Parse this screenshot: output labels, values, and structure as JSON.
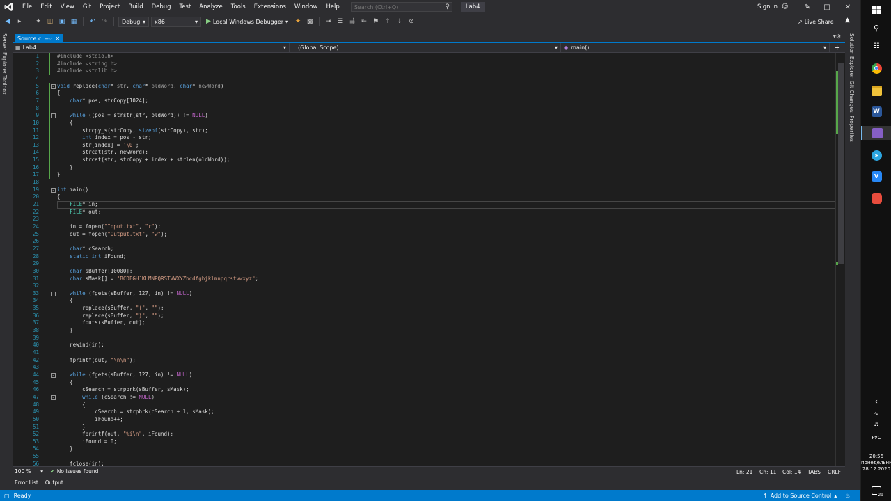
{
  "menu": {
    "items": [
      "File",
      "Edit",
      "View",
      "Git",
      "Project",
      "Build",
      "Debug",
      "Test",
      "Analyze",
      "Tools",
      "Extensions",
      "Window",
      "Help"
    ],
    "search_placeholder": "Search (Ctrl+Q)",
    "solution_name": "Lab4",
    "sign_in": "Sign in"
  },
  "toolbar": {
    "configuration": "Debug",
    "platform": "x86",
    "run_label": "Local Windows Debugger",
    "live_share": "Live Share"
  },
  "side_tabs": {
    "left": [
      "Server Explorer",
      "Toolbox"
    ],
    "right": [
      "Solution Explorer",
      "Git Changes",
      "Properties"
    ]
  },
  "document": {
    "tab_label": "Source.c",
    "nav_project": "Lab4",
    "nav_scope": "(Global Scope)",
    "nav_function": "main()"
  },
  "editor": {
    "current_line": 21,
    "lines": [
      "#include <stdio.h>",
      "#include <string.h>",
      "#include <stdlib.h>",
      "",
      "void replace(char* str, char* oldWord, char* newWord)",
      "{",
      "    char* pos, strCopy[1024];",
      "",
      "    while ((pos = strstr(str, oldWord)) != NULL)",
      "    {",
      "        strcpy_s(strCopy, sizeof(strCopy), str);",
      "        int index = pos - str;",
      "        str[index] = '\\0';",
      "        strcat(str, newWord);",
      "        strcat(str, strCopy + index + strlen(oldWord));",
      "    }",
      "}",
      "",
      "int main()",
      "{",
      "    FILE* in;",
      "    FILE* out;",
      "",
      "    in = fopen(\"Input.txt\", \"r\");",
      "    out = fopen(\"Output.txt\", \"w\");",
      "",
      "    char* cSearch;",
      "    static int iFound;",
      "",
      "    char sBuffer[10000];",
      "    char sMask[] = \"BCDFGHJKLMNPQRSTVWXYZbcdfghjklmnpqrstvwxyz\";",
      "",
      "    while (fgets(sBuffer, 127, in) != NULL)",
      "    {",
      "        replace(sBuffer, \"(\", \"\");",
      "        replace(sBuffer, \")\", \"\");",
      "        fputs(sBuffer, out);",
      "    }",
      "",
      "    rewind(in);",
      "",
      "    fprintf(out, \"\\n\\n\");",
      "",
      "    while (fgets(sBuffer, 127, in) != NULL)",
      "    {",
      "        cSearch = strpbrk(sBuffer, sMask);",
      "        while (cSearch != NULL)",
      "        {",
      "            cSearch = strpbrk(cSearch + 1, sMask);",
      "            iFound++;",
      "        }",
      "        fprintf(out, \"%i\\n\", iFound);",
      "        iFound = 0;",
      "    }",
      "",
      "    fclose(in);"
    ]
  },
  "status_strip": {
    "zoom": "100 %",
    "issues": "No issues found",
    "ln": "Ln: 21",
    "ch": "Ch: 11",
    "col": "Col: 14",
    "indent": "TABS",
    "eol": "CRLF"
  },
  "bottom_tabs": [
    "Error List",
    "Output"
  ],
  "statusbar": {
    "ready": "Ready",
    "source_control": "Add to Source Control"
  },
  "taskbar": {
    "lang": "РУС",
    "time": "20:56",
    "day": "понедельник",
    "date": "28.12.2020",
    "notif_count": "29"
  },
  "colors": {
    "accent": "#007acc",
    "keyword": "#569cd6",
    "string": "#d69d85",
    "line_number": "#2b91af",
    "change_bar": "#57a64a"
  }
}
